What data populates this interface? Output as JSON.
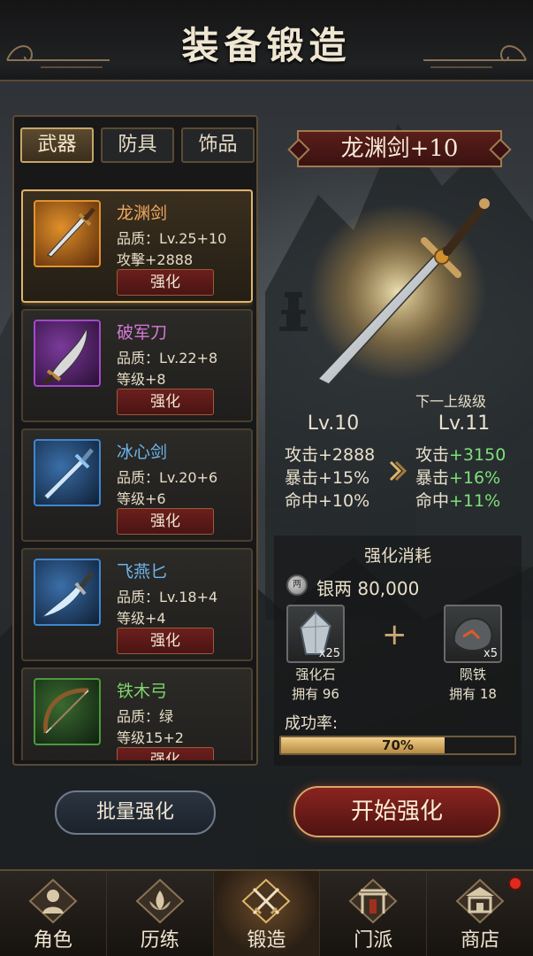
{
  "header": {
    "title": "装备锻造"
  },
  "tabs": [
    {
      "label": "武器",
      "active": true
    },
    {
      "label": "防具",
      "active": false
    },
    {
      "label": "饰品",
      "active": false
    }
  ],
  "items": [
    {
      "name": "龙渊剑",
      "line1": "品质：Lv.25+10",
      "line2": "攻擊+2888",
      "button": "强化",
      "name_color": "#f0a860",
      "frame_color": "#e0922e",
      "bg_color": "#b0601a",
      "icon": "sword-icon",
      "selected": true
    },
    {
      "name": "破军刀",
      "line1": "品质：Lv.22+8",
      "line2": "等级+8",
      "button": "强化",
      "name_color": "#d57ad8",
      "frame_color": "#a24ac8",
      "bg_color": "#4a1d5c",
      "icon": "saber-icon",
      "selected": false
    },
    {
      "name": "冰心剑",
      "line1": "品质：Lv.20+6",
      "line2": "等级+6",
      "button": "强化",
      "name_color": "#6cb6ee",
      "frame_color": "#3f86d0",
      "bg_color": "#1d3d62",
      "icon": "ice-sword-icon",
      "selected": false
    },
    {
      "name": "飞燕匕",
      "line1": "品质：Lv.18+4",
      "line2": "等级+4",
      "button": "强化",
      "name_color": "#6cb6ee",
      "frame_color": "#3f86d0",
      "bg_color": "#1d3d62",
      "icon": "dagger-icon",
      "selected": false
    },
    {
      "name": "铁木弓",
      "line1": "品质：绿",
      "line2": "等级15+2",
      "button": "强化",
      "name_color": "#7ed66a",
      "frame_color": "#4a9a3c",
      "bg_color": "#1f3d1c",
      "icon": "bow-icon",
      "selected": false
    }
  ],
  "detail": {
    "title": "龙渊剑+10",
    "next_label": "下一上级级",
    "current": {
      "level": "Lv.10",
      "attack": "攻击+2888",
      "crit": "暴击+15%",
      "hit": "命中+10%"
    },
    "next": {
      "level": "Lv.11",
      "attack_label": "攻击",
      "attack_value": "+3150",
      "crit_label": "暴击",
      "crit_value": "+16%",
      "hit_label": "命中",
      "hit_value": "+11%"
    }
  },
  "cost": {
    "title": "强化消耗",
    "coin_glyph": "两",
    "silver": "银两 80,000",
    "materials": [
      {
        "name": "强化石",
        "count": "x25",
        "owned": "拥有 96",
        "icon": "crystal-icon"
      },
      {
        "name": "陨铁",
        "count": "x5",
        "owned": "拥有 18",
        "icon": "meteorite-icon"
      }
    ],
    "plus": "+",
    "rate_label": "成功率:",
    "rate_text": "70%",
    "rate_value": 0.7
  },
  "buttons": {
    "batch": "批量强化",
    "start": "开始强化"
  },
  "nav": [
    {
      "label": "角色",
      "icon": "character-icon",
      "active": false,
      "badge": false
    },
    {
      "label": "历练",
      "icon": "lotus-icon",
      "active": false,
      "badge": false
    },
    {
      "label": "锻造",
      "icon": "crossed-swords-icon",
      "active": true,
      "badge": false
    },
    {
      "label": "门派",
      "icon": "gate-icon",
      "active": false,
      "badge": false
    },
    {
      "label": "商店",
      "icon": "shop-icon",
      "active": false,
      "badge": true
    }
  ],
  "colors": {
    "accent_gold": "#e0b56a",
    "stat_up_green": "#7ee07a",
    "button_red": "#8a2420"
  }
}
